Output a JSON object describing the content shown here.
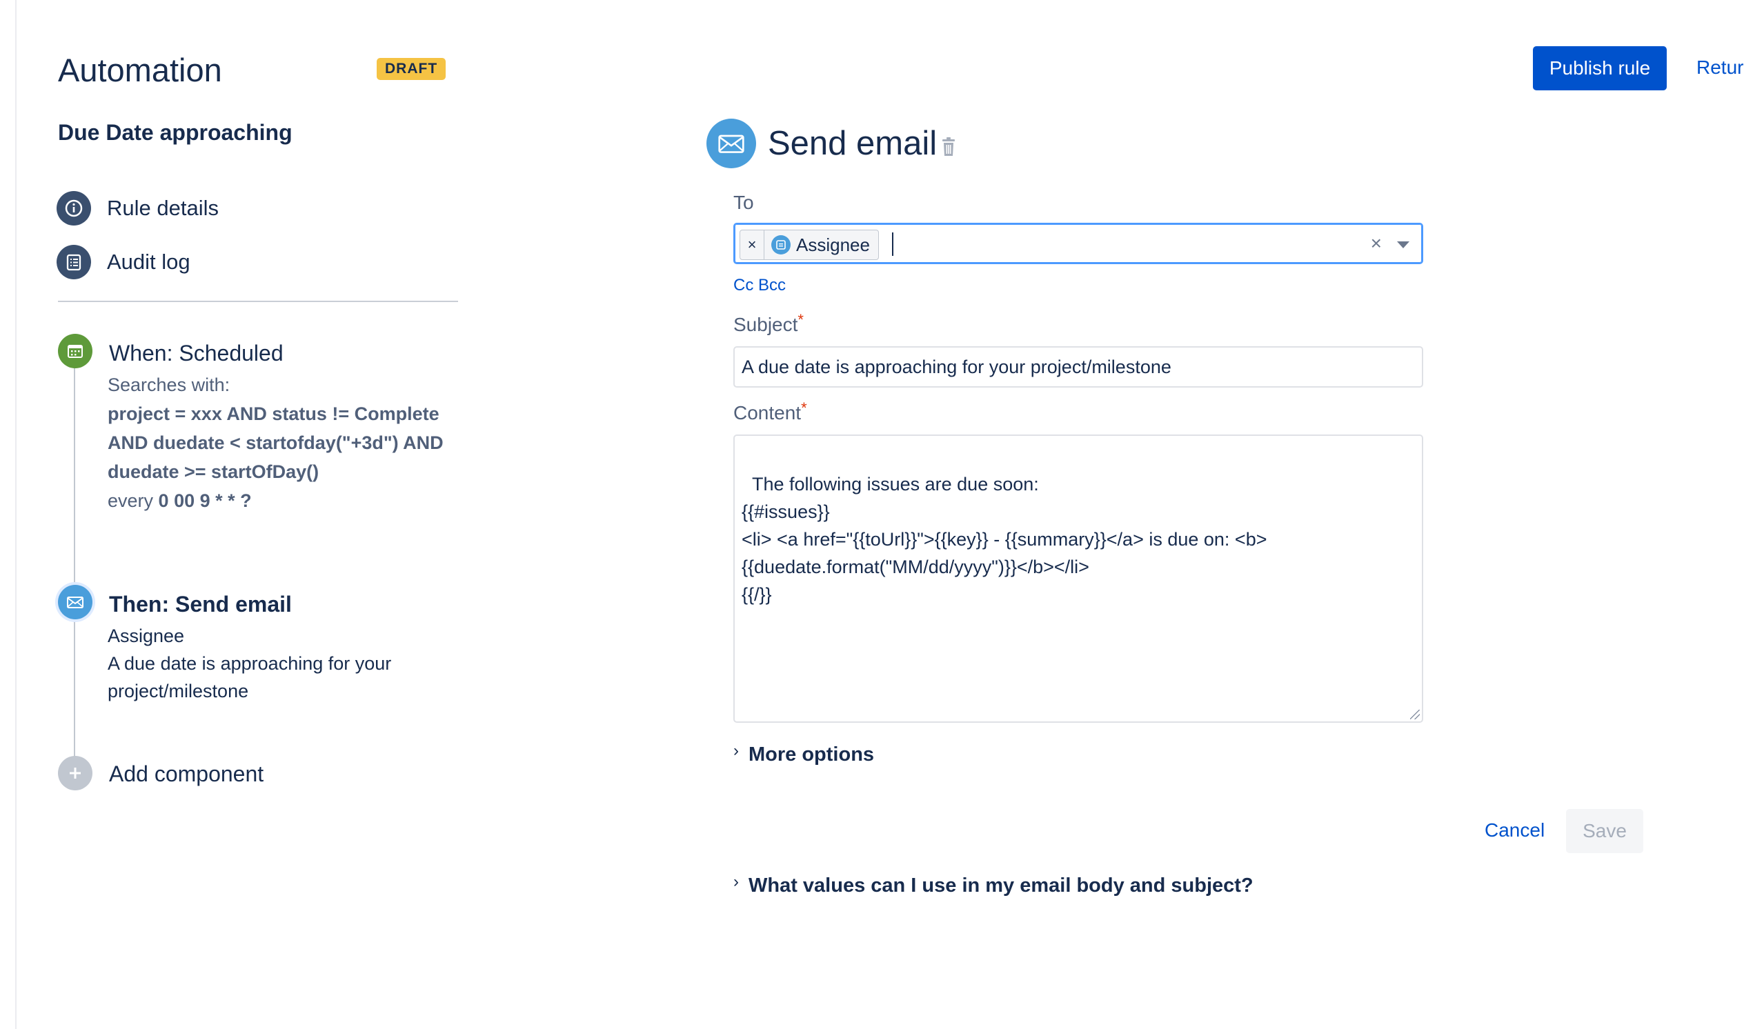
{
  "header": {
    "title": "Automation",
    "badge": "DRAFT",
    "publish_label": "Publish rule",
    "return_label": "Retur"
  },
  "rule": {
    "name": "Due Date approaching"
  },
  "nav": {
    "items": [
      {
        "label": "Rule details",
        "icon": "info-icon"
      },
      {
        "label": "Audit log",
        "icon": "list-icon"
      }
    ]
  },
  "timeline": {
    "trigger": {
      "title": "When: Scheduled",
      "searches_label": "Searches with:",
      "query_line1": "project = xxx AND status != Complete",
      "query_line2": "AND duedate < startofday(\"+3d\") AND",
      "query_line3": "duedate >= startOfDay()",
      "every_label": "every",
      "cron": "0 00 9 * * ?",
      "icon": "calendar-icon",
      "color": "#5e9a3a"
    },
    "action": {
      "title": "Then: Send email",
      "recipient": "Assignee",
      "subject_line1": "A due date is approaching for your",
      "subject_line2": "project/milestone",
      "icon": "mail-icon",
      "color": "#4a9edb"
    },
    "add": {
      "label": "Add component",
      "icon": "plus-icon"
    }
  },
  "panel": {
    "title": "Send email",
    "to_label": "To",
    "to_chip": "Assignee",
    "cc_bcc": "Cc Bcc",
    "subject_label": "Subject",
    "subject_value": "A due date is approaching for your project/milestone",
    "content_label": "Content",
    "content_value": "The following issues are due soon:\n{{#issues}}\n<li> <a href=\"{{toUrl}}\">{{key}} - {{summary}}</a> is due on: <b>\n{{duedate.format(\"MM/dd/yyyy\")}}</b></li>\n{{/}}",
    "more_options": "More options",
    "cancel_label": "Cancel",
    "save_label": "Save",
    "help_label": "What values can I use in my email body and subject?"
  },
  "colors": {
    "primary": "#0052cc",
    "badge": "#f5c344",
    "required": "#de350b"
  }
}
